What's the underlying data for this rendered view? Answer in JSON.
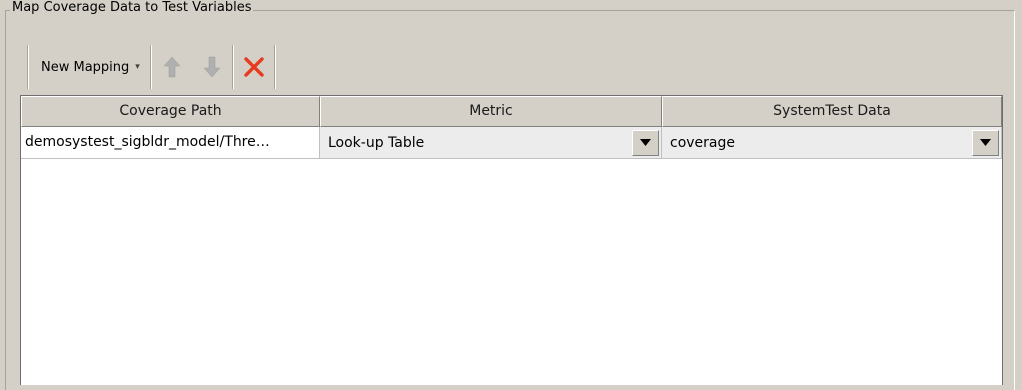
{
  "panel": {
    "title": "Map Coverage Data to Test Variables"
  },
  "toolbar": {
    "new_mapping_label": "New Mapping",
    "icons": [
      "arrow-up-icon",
      "arrow-down-icon",
      "delete-x-icon"
    ],
    "delete_color": "#e63c1e"
  },
  "table": {
    "headers": [
      "Coverage Path",
      "Metric",
      "SystemTest Data"
    ],
    "rows": [
      {
        "coverage_path": "demosystest_sigbldr_model/Thre…",
        "metric": "Look-up Table",
        "systemtest_data": "coverage"
      }
    ]
  }
}
